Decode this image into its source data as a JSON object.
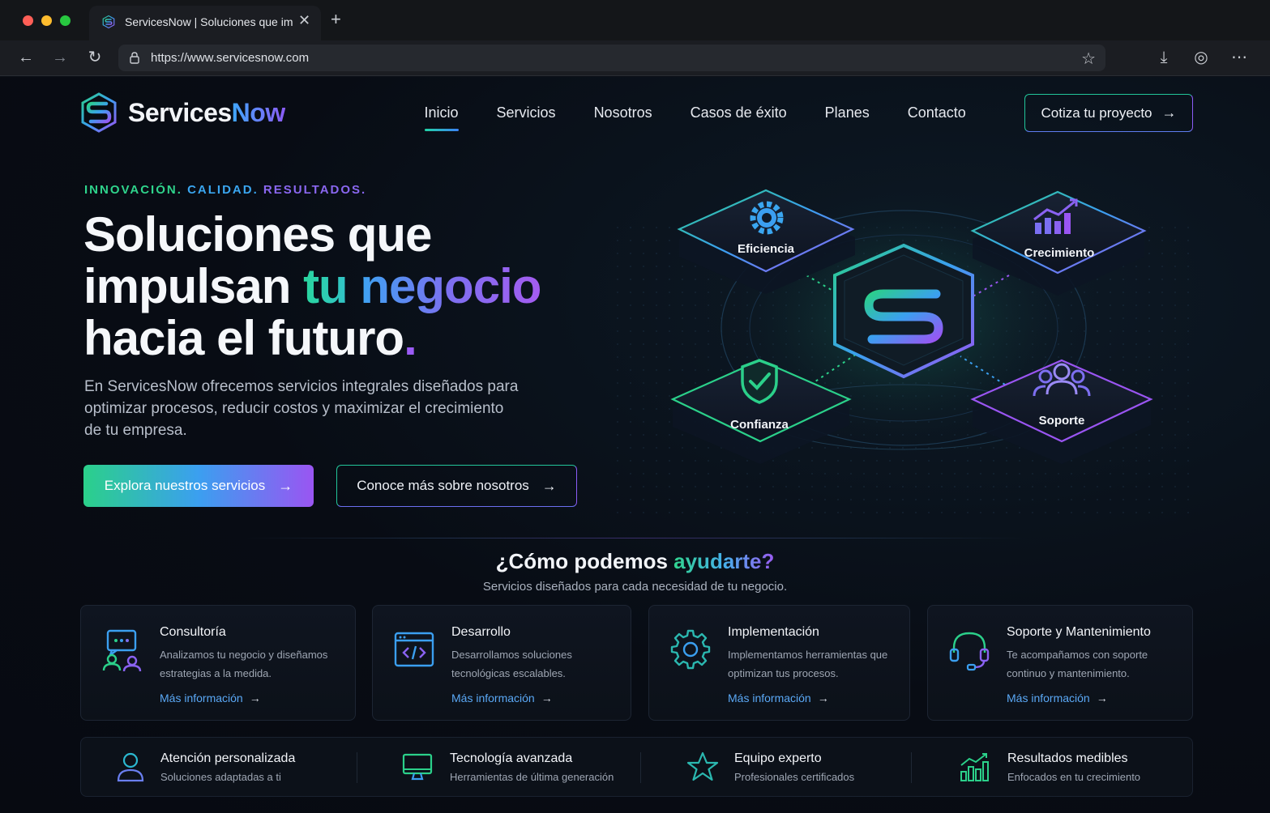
{
  "browser": {
    "tab_title": "ServicesNow | Soluciones que impulsan",
    "tab_close": "✕",
    "new_tab": "+",
    "url": "https://www.servicesnow.com",
    "back": "←",
    "forward": "→",
    "reload": "↻",
    "bookmark": "☆",
    "download": "⤓",
    "profile": "◎",
    "more": "⋯"
  },
  "header": {
    "logo_part1": "Services",
    "logo_part2": "Now",
    "nav": [
      "Inicio",
      "Servicios",
      "Nosotros",
      "Casos de éxito",
      "Planes",
      "Contacto"
    ],
    "active_nav": "Inicio",
    "cta": "Cotiza tu proyecto",
    "arrow": "→"
  },
  "hero": {
    "eyebrow": [
      "INNOVACIÓN.",
      "CALIDAD.",
      "RESULTADOS."
    ],
    "headline_line1": "Soluciones que",
    "headline_line2_plain": "impulsan ",
    "headline_line2_grad1": "tu",
    "headline_line2_grad2": "negocio",
    "headline_line3": "hacia el futuro",
    "headline_period": ".",
    "lead": "En ServicesNow ofrecemos servicios integrales diseñados para optimizar procesos, reducir costos y maximizar el crecimiento de tu empresa.",
    "btn_primary": "Explora nuestros servicios",
    "btn_secondary": "Conoce más sobre nosotros",
    "tiles": [
      "Eficiencia",
      "Crecimiento",
      "Confianza",
      "Soporte"
    ]
  },
  "services_section": {
    "title_plain": "¿Cómo podemos ",
    "title_grad": "ayudarte?",
    "subtitle": "Servicios diseñados para cada necesidad de tu negocio.",
    "link_label": "Más información",
    "cards": [
      {
        "title": "Consultoría",
        "desc": "Analizamos tu negocio y diseñamos estrategias a la medida.",
        "icon": "consulting-icon"
      },
      {
        "title": "Desarrollo",
        "desc": "Desarrollamos soluciones tecnológicas escalables.",
        "icon": "code-window-icon"
      },
      {
        "title": "Implementación",
        "desc": "Implementamos herramientas que optimizan tus procesos.",
        "icon": "gear-icon"
      },
      {
        "title": "Soporte y Mantenimiento",
        "desc": "Te acompañamos con soporte continuo y mantenimiento.",
        "icon": "headset-icon"
      }
    ]
  },
  "features": [
    {
      "title": "Atención personalizada",
      "desc": "Soluciones adaptadas a ti",
      "icon": "user-icon"
    },
    {
      "title": "Tecnología avanzada",
      "desc": "Herramientas de última generación",
      "icon": "monitor-icon"
    },
    {
      "title": "Equipo experto",
      "desc": "Profesionales certificados",
      "icon": "star-icon"
    },
    {
      "title": "Resultados medibles",
      "desc": "Enfocados en tu crecimiento",
      "icon": "bar-chart-icon"
    }
  ],
  "colors": {
    "green": "#2bd08a",
    "blue": "#3b9ff0",
    "purple": "#9a55f2",
    "background": "#080c14"
  }
}
